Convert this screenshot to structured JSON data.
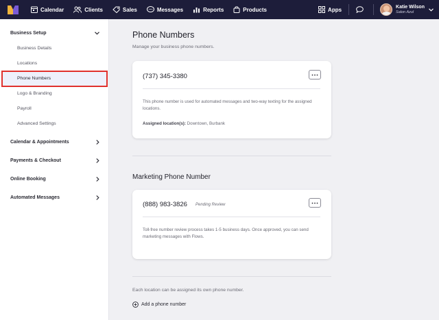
{
  "nav": {
    "items": [
      {
        "label": "Calendar",
        "icon": "calendar-icon"
      },
      {
        "label": "Clients",
        "icon": "clients-icon"
      },
      {
        "label": "Sales",
        "icon": "tag-icon"
      },
      {
        "label": "Messages",
        "icon": "chat-bubble-icon"
      },
      {
        "label": "Reports",
        "icon": "bar-chart-icon"
      },
      {
        "label": "Products",
        "icon": "bag-icon"
      }
    ],
    "apps_label": "Apps",
    "user": {
      "name": "Katie Wilson",
      "org": "Salon Azul"
    }
  },
  "sidebar": {
    "business_setup": "Business Setup",
    "sub_items": [
      "Business Details",
      "Locations",
      "Phone Numbers",
      "Logo & Branding",
      "Payroll",
      "Advanced Settings"
    ],
    "sections": [
      "Calendar & Appointments",
      "Payments & Checkout",
      "Online Booking",
      "Automated Messages"
    ]
  },
  "main": {
    "title": "Phone Numbers",
    "subtitle": "Manage your business phone numbers.",
    "card1": {
      "phone": "(737) 345-3380",
      "desc": "This phone number is used for automated messages and two-way texting for the assigned locations.",
      "assigned_label": "Assigned location(s):",
      "assigned_value": "Downtown, Burbank"
    },
    "marketing_title": "Marketing Phone Number",
    "card2": {
      "phone": "(888) 983-3826",
      "status": "Pending Review",
      "desc": "Toll-free number review process takes 1-5 business days. Once approved, you can send marketing messages with Flows."
    },
    "note": "Each location can be assigned its own phone number.",
    "add_label": "Add a phone number"
  },
  "colors": {
    "nav_bg": "#1d1d3a",
    "active_bg": "#eef0fb",
    "highlight_border": "#e0302c"
  }
}
